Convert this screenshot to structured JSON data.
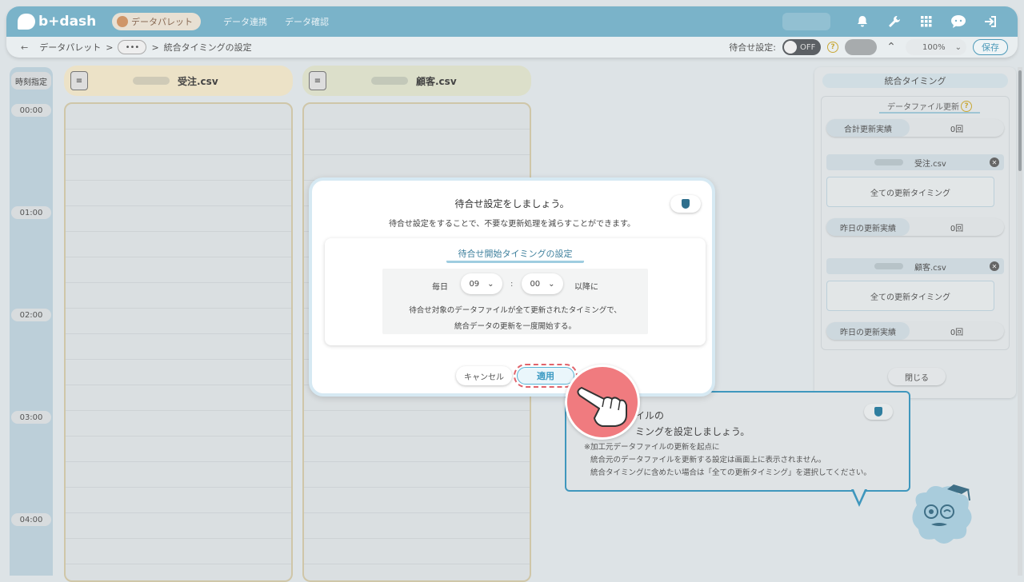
{
  "app": {
    "logo_text": "b+dash"
  },
  "nav": {
    "active": "データパレット",
    "links": [
      "データ連携",
      "データ確認"
    ]
  },
  "breadcrumb": {
    "root": "データパレット",
    "sep": ">",
    "ellipsis": "•••",
    "current": "統合タイミングの設定"
  },
  "toolbar": {
    "wait_label": "待合せ設定:",
    "toggle_state": "OFF",
    "zoom": "100%",
    "save_label": "保存"
  },
  "timeline": {
    "header": "時刻指定",
    "ticks": [
      "00:00",
      "01:00",
      "02:00",
      "03:00",
      "04:00"
    ]
  },
  "files": [
    {
      "name": "受注.csv",
      "accent": "#ece2c7"
    },
    {
      "name": "顧客.csv",
      "accent": "#dcdfca"
    }
  ],
  "side_panel": {
    "title": "統合タイミング",
    "subtitle": "データファイル更新",
    "total_label": "合計更新実績",
    "total_value": "0回",
    "entries": [
      {
        "file": "受注.csv",
        "timing": "全ての更新タイミング",
        "yesterday_label": "昨日の更新実績",
        "yesterday_value": "0回"
      },
      {
        "file": "顧客.csv",
        "timing": "全ての更新タイミング",
        "yesterday_label": "昨日の更新実績",
        "yesterday_value": "0回"
      }
    ],
    "close_label": "閉じる"
  },
  "bubble": {
    "line1": "イルの",
    "line2": "ミングを設定しましょう。",
    "notes": [
      "※加工元データファイルの更新を起点に",
      "統合元のデータファイルを更新する設定は画面上に表示されません。",
      "統合タイミングに含めたい場合は「全ての更新タイミング」を選択してください。"
    ]
  },
  "modal": {
    "title": "待合せ設定をしましょう。",
    "subtitle": "待合せ設定をすることで、不要な更新処理を減らすことができます。",
    "card_title": "待合せ開始タイミングの設定",
    "daily_label": "毎日",
    "hour": "09",
    "colon": ":",
    "minute": "00",
    "after_label": "以降に",
    "desc1": "待合せ対象のデータファイルが全て更新されたタイミングで、",
    "desc2": "統合データの更新を一度開始する。",
    "cancel_label": "キャンセル",
    "apply_label": "適用"
  },
  "colors": {
    "header_blue": "#7ab3c9",
    "accent_blue": "#3f97bd",
    "pointer_red": "#f07b7f"
  },
  "icons": [
    "bell-icon",
    "wrench-icon",
    "grid-icon",
    "chat-icon",
    "logout-icon",
    "back-arrow-icon",
    "help-icon",
    "caret-up-icon",
    "shield-icon",
    "hand-pointer-icon",
    "file-icon",
    "close-icon"
  ]
}
